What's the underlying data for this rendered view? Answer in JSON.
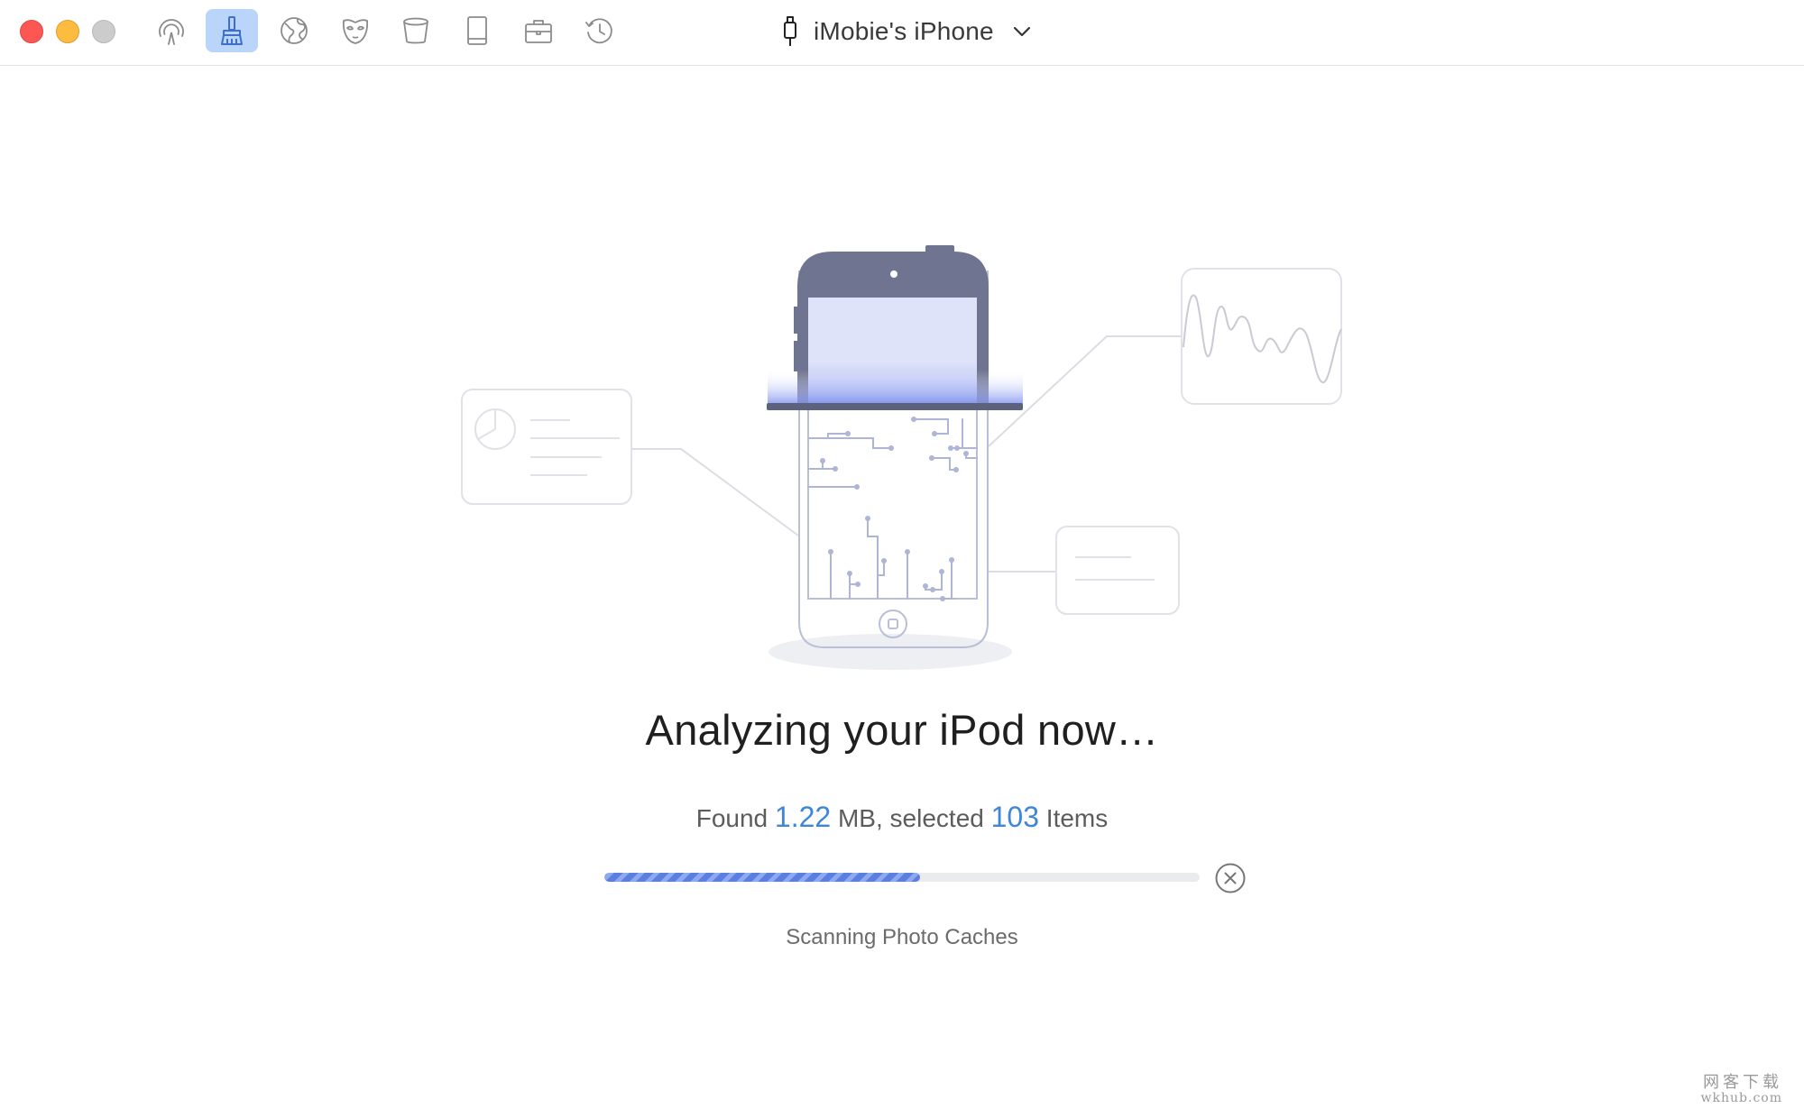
{
  "window": {
    "device_name": "iMobie's iPhone"
  },
  "toolbar": {
    "items": [
      {
        "icon": "airdrop-icon",
        "active": false
      },
      {
        "icon": "cleaner-brush-icon",
        "active": true
      },
      {
        "icon": "globe-icon",
        "active": false
      },
      {
        "icon": "privacy-mask-icon",
        "active": false
      },
      {
        "icon": "trash-bin-icon",
        "active": false
      },
      {
        "icon": "book-icon",
        "active": false
      },
      {
        "icon": "toolbox-icon",
        "active": false
      },
      {
        "icon": "history-icon",
        "active": false
      }
    ]
  },
  "main": {
    "headline": "Analyzing your iPod now…",
    "found_prefix": "Found",
    "found_size": "1.22",
    "found_size_unit": "MB, selected",
    "found_count": "103",
    "found_suffix": "Items",
    "progress": 0.53,
    "status": "Scanning Photo Caches"
  },
  "watermark": {
    "line1": "网客下载",
    "line2": "wkhub.com"
  },
  "colors": {
    "accent": "#3d86d9",
    "active_tab": "#b9d5f9",
    "progress": "#5a7fe0",
    "phone_body": "#6f7490"
  }
}
